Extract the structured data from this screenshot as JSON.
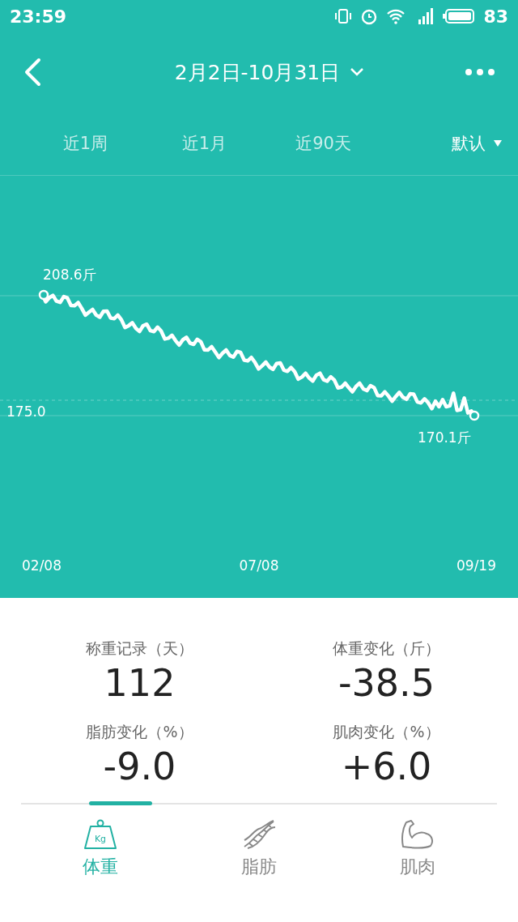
{
  "status_bar": {
    "time": "23:59",
    "battery": "83"
  },
  "header": {
    "title": "2月2日-10月31日"
  },
  "periods": [
    {
      "label": "近1周",
      "selected": false
    },
    {
      "label": "近1月",
      "selected": false
    },
    {
      "label": "近90天",
      "selected": false
    },
    {
      "label": "默认",
      "selected": true,
      "kind": "dropdown"
    }
  ],
  "chart": {
    "start_label": "208.6斤",
    "end_label": "170.1斤",
    "reference_label": "175.0",
    "x_labels": [
      "02/08",
      "07/08",
      "09/19"
    ]
  },
  "stats": [
    {
      "label": "称重记录（天）",
      "value": "112"
    },
    {
      "label": "体重变化（斤）",
      "value": "-38.5"
    },
    {
      "label": "脂肪变化（%）",
      "value": "-9.0"
    },
    {
      "label": "肌肉变化（%）",
      "value": "+6.0"
    }
  ],
  "bottom_tabs": [
    {
      "label": "体重",
      "kind": "weight",
      "icon_text": "Kg",
      "selected": true
    },
    {
      "label": "脂肪",
      "kind": "dna",
      "selected": false
    },
    {
      "label": "肌肉",
      "kind": "muscle",
      "selected": false
    }
  ]
}
